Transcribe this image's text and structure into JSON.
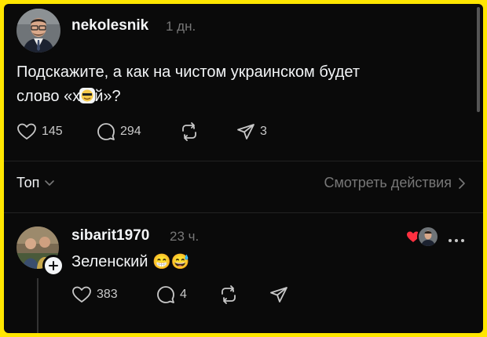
{
  "post": {
    "username": "nekolesnik",
    "time": "1 дн.",
    "text_line1": "Подскажите, а как на чистом украинском будет",
    "text_line2_before": "слово «х",
    "text_line2_after": "й»?",
    "likes": "145",
    "comments": "294",
    "shares": "3"
  },
  "sort": {
    "label": "Топ",
    "view_activity": "Смотреть действия"
  },
  "reply": {
    "username": "sibarit1970",
    "time": "23 ч.",
    "text": "Зеленский",
    "emojis": "😁😅",
    "likes": "383",
    "comments": "4"
  },
  "colors": {
    "border": "#ffe600",
    "background": "#0a0a0a",
    "like_heart": "#ff3040"
  }
}
